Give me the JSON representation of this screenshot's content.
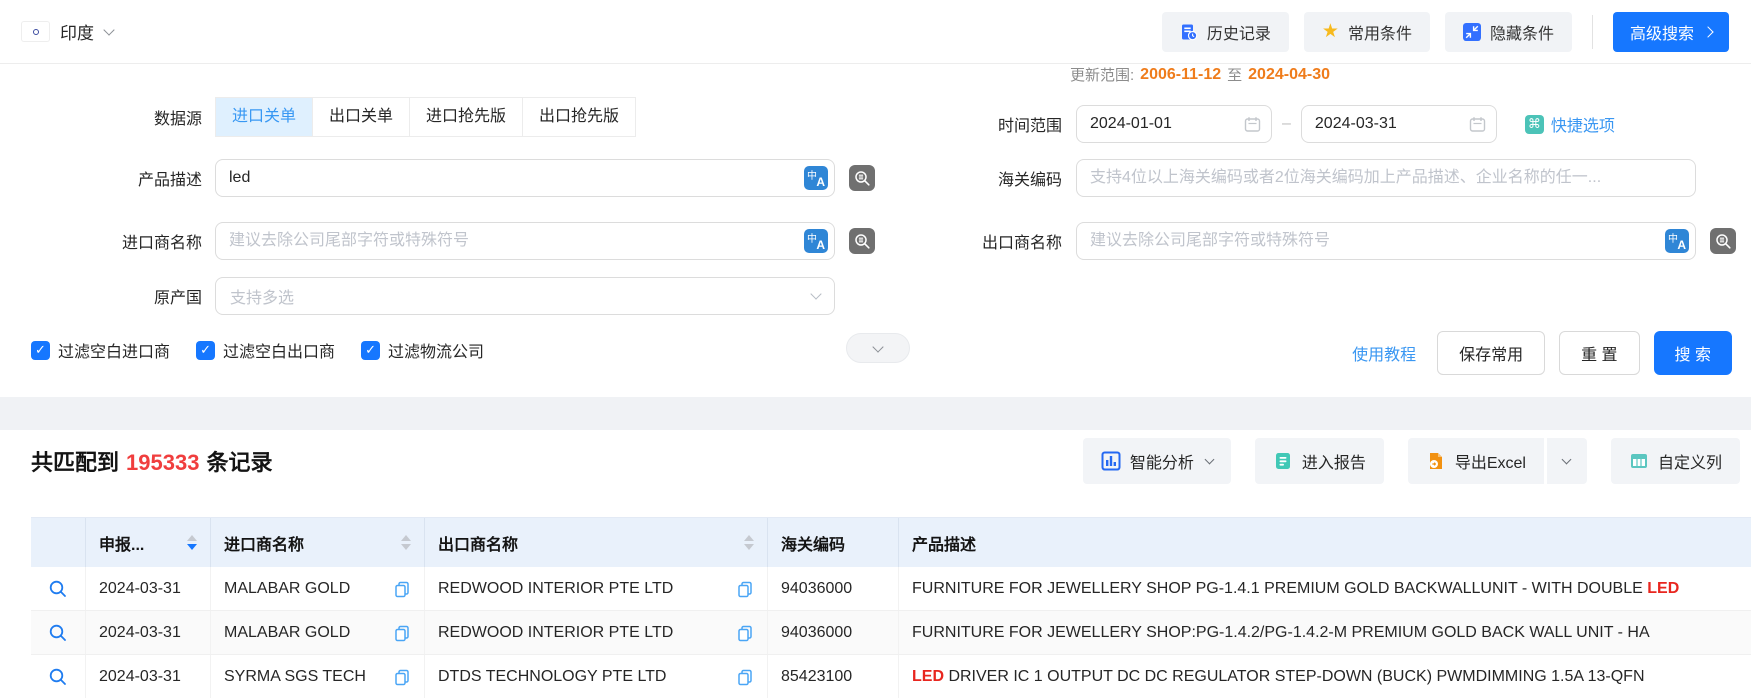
{
  "header": {
    "country": "印度",
    "history_btn": "历史记录",
    "favorites_btn": "常用条件",
    "hide_btn": "隐藏条件",
    "advanced_btn": "高级搜索"
  },
  "filters": {
    "data_source_label": "数据源",
    "tabs": [
      {
        "label": "进口关单",
        "active": true
      },
      {
        "label": "出口关单",
        "active": false
      },
      {
        "label": "进口抢先版",
        "active": false
      },
      {
        "label": "出口抢先版",
        "active": false
      }
    ],
    "update_range": {
      "label": "更新范围:",
      "from": "2006-11-12",
      "to_word": "至",
      "to": "2024-04-30"
    },
    "time_range": {
      "label": "时间范围",
      "start": "2024-01-01",
      "end": "2024-03-31"
    },
    "quick_options": "快捷选项",
    "product_desc": {
      "label": "产品描述",
      "value": "led"
    },
    "hs_code": {
      "label": "海关编码",
      "placeholder": "支持4位以上海关编码或者2位海关编码加上产品描述、企业名称的任一..."
    },
    "importer": {
      "label": "进口商名称",
      "placeholder": "建议去除公司尾部字符或特殊符号"
    },
    "exporter": {
      "label": "出口商名称",
      "placeholder": "建议去除公司尾部字符或特殊符号"
    },
    "origin_country": {
      "label": "原产国",
      "placeholder": "支持多选"
    },
    "checkboxes": [
      {
        "label": "过滤空白进口商",
        "checked": true
      },
      {
        "label": "过滤空白出口商",
        "checked": true
      },
      {
        "label": "过滤物流公司",
        "checked": true
      }
    ],
    "tutorial_link": "使用教程",
    "save_btn": "保存常用",
    "reset_btn": "重 置",
    "search_btn": "搜 索"
  },
  "results": {
    "summary": {
      "prefix": "共匹配到",
      "count": "195333",
      "suffix": "条记录"
    },
    "analysis_btn": "智能分析",
    "report_btn": "进入报告",
    "export_btn": "导出Excel",
    "columns_btn": "自定义列",
    "table": {
      "headers": [
        "申报...",
        "进口商名称",
        "出口商名称",
        "海关编码",
        "产品描述"
      ],
      "rows": [
        {
          "date": "2024-03-31",
          "importer": "MALABAR GOLD",
          "exporter": "REDWOOD INTERIOR PTE LTD",
          "hs_code": "94036000",
          "desc_pre": "FURNITURE FOR JEWELLERY SHOP PG-1.4.1 PREMIUM GOLD BACKWALLUNIT - WITH DOUBLE ",
          "desc_match": "LED",
          "desc_post": ""
        },
        {
          "date": "2024-03-31",
          "importer": "MALABAR GOLD",
          "exporter": "REDWOOD INTERIOR PTE LTD",
          "hs_code": "94036000",
          "desc_pre": "FURNITURE FOR JEWELLERY SHOP:PG-1.4.2/PG-1.4.2-M PREMIUM GOLD BACK WALL UNIT - HA",
          "desc_match": "",
          "desc_post": ""
        },
        {
          "date": "2024-03-31",
          "importer": "SYRMA SGS TECH",
          "exporter": "DTDS TECHNOLOGY PTE LTD",
          "hs_code": "85423100",
          "desc_pre": "",
          "desc_match": "LED",
          "desc_post": " DRIVER IC 1 OUTPUT DC DC REGULATOR STEP-DOWN (BUCK) PWMDIMMING 1.5A 13-QFN"
        }
      ]
    }
  },
  "colors": {
    "primary": "#1677ff",
    "date_orange": "#ef7c1b",
    "count_red": "#f03e3e",
    "match_red": "#e8261f"
  }
}
